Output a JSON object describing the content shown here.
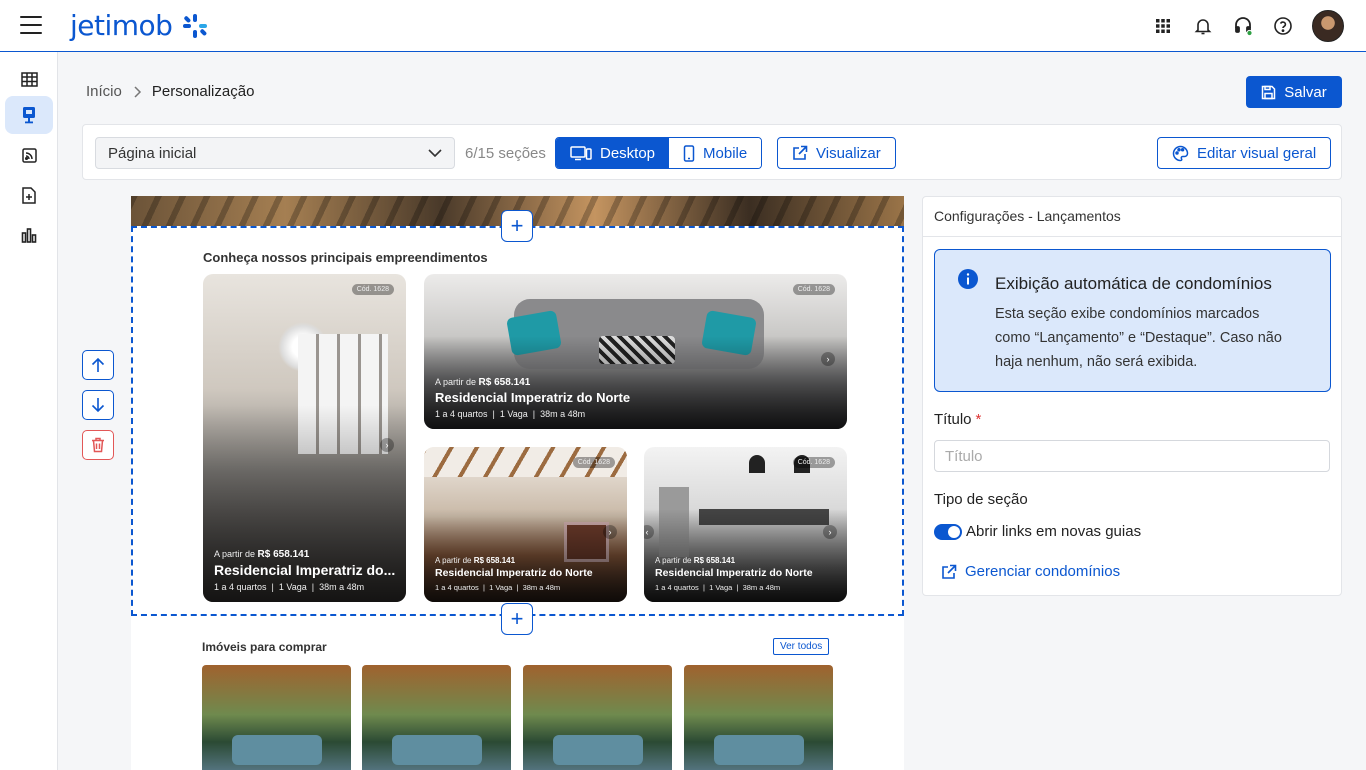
{
  "app": {
    "logo_text": "jetimob"
  },
  "colors": {
    "accent": "#0b57d0",
    "alert_bg": "#dbe8fb",
    "danger": "#e25757"
  },
  "topbar": {
    "icons": [
      "apps-grid-icon",
      "bell-icon",
      "support-headset-icon",
      "help-icon"
    ]
  },
  "sidebar": {
    "items": [
      "table-icon",
      "site-icon",
      "rss-icon",
      "document-add-icon",
      "chart-icon"
    ],
    "active_index": 1
  },
  "breadcrumb": {
    "home": "Início",
    "current": "Personalização"
  },
  "actions": {
    "save_label": "Salvar"
  },
  "toolbar": {
    "page_select_value": "Página inicial",
    "sections_count": "6/15 seções",
    "desktop_label": "Desktop",
    "mobile_label": "Mobile",
    "preview_label": "Visualizar",
    "edit_visual_label": "Editar visual geral"
  },
  "preview": {
    "section_title": "Conheça nossos principais empreendimentos",
    "cards": [
      {
        "code": "Cód. 1628",
        "from_label": "A partir de",
        "price": "R$ 658.141",
        "name": "Residencial Imperatriz do...",
        "rooms": "1 a 4 quartos",
        "parking": "1 Vaga",
        "area": "38m a 48m"
      },
      {
        "code": "Cód. 1628",
        "from_label": "A partir de",
        "price": "R$ 658.141",
        "name": "Residencial Imperatriz do Norte",
        "rooms": "1 a 4 quartos",
        "parking": "1 Vaga",
        "area": "38m a 48m"
      },
      {
        "code": "Cód. 1628",
        "from_label": "A partir de",
        "price": "R$ 658.141",
        "name": "Residencial Imperatriz do Norte",
        "rooms": "1 a 4 quartos",
        "parking": "1 Vaga",
        "area": "38m a 48m"
      },
      {
        "code": "Cód. 1628",
        "from_label": "A partir de",
        "price": "R$ 658.141",
        "name": "Residencial Imperatriz do Norte",
        "rooms": "1 a 4 quartos",
        "parking": "1 Vaga",
        "area": "38m a 48m"
      }
    ],
    "buy_section_title": "Imóveis para comprar",
    "see_all_label": "Ver todos"
  },
  "panel": {
    "header": "Configurações - Lançamentos",
    "alert_title": "Exibição automática de condomínios",
    "alert_body": "Esta seção exibe condomínios marcados como “Lançamento” e “Destaque”. Caso não haja nenhum, não será exibida.",
    "title_label": "Título",
    "title_required": "*",
    "title_placeholder": "Título",
    "section_type_label": "Tipo de seção",
    "toggle_label": "Abrir links em novas guias",
    "toggle_on": true,
    "manage_link": "Gerenciar condomínios"
  }
}
